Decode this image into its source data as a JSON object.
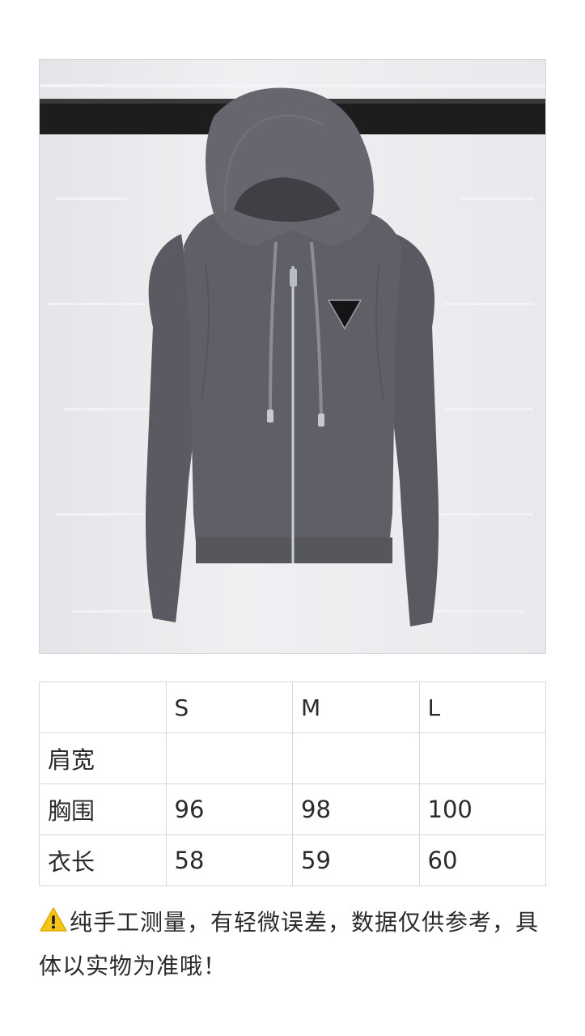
{
  "product_photo": {
    "alt": "grey zip-up hooded knit jacket with triangle logo badge",
    "colors": {
      "background": "#e9ebee",
      "rail": "#1d1d1d",
      "garment": "#5f6067",
      "garment_shadow": "#4e4f55",
      "zipper": "#c9ccd1"
    }
  },
  "size_table": {
    "headers": [
      "",
      "S",
      "M",
      "L"
    ],
    "rows": [
      {
        "label": "肩宽",
        "values": [
          "",
          "",
          ""
        ]
      },
      {
        "label": "胸围",
        "values": [
          "96",
          "98",
          "100"
        ]
      },
      {
        "label": "衣长",
        "values": [
          "58",
          "59",
          "60"
        ]
      }
    ]
  },
  "note": {
    "icon": "warning-icon",
    "text": "纯手工测量，有轻微误差，数据仅供参考，具体以实物为准哦！"
  }
}
